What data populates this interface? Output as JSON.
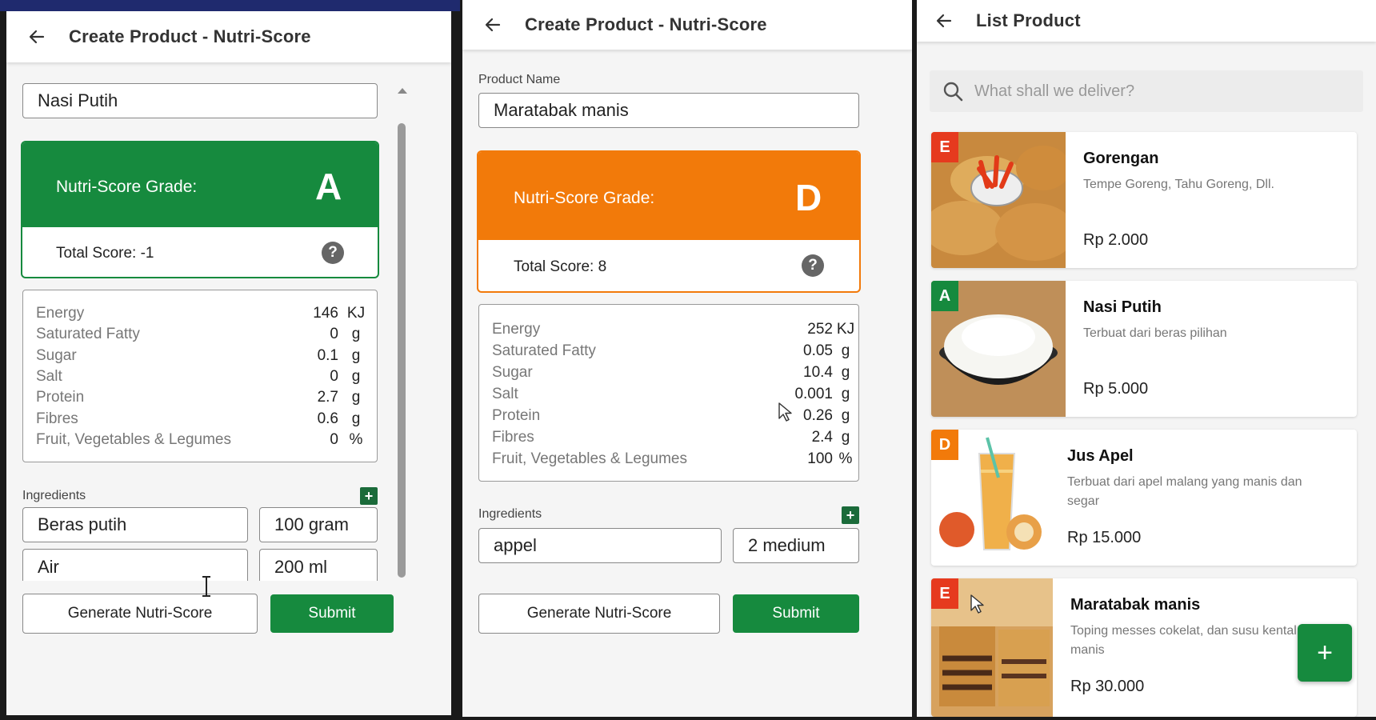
{
  "panel_left": {
    "title": "Create Product - Nutri-Score",
    "product_name_value": "Nasi Putih",
    "grade": {
      "label": "Nutri-Score Grade:",
      "letter": "A",
      "color": "#168a3e",
      "total_score": "Total Score: -1"
    },
    "nutrients": [
      {
        "name": "Energy",
        "value": "146",
        "unit": "KJ"
      },
      {
        "name": "Saturated Fatty",
        "value": "0",
        "unit": "g"
      },
      {
        "name": "Sugar",
        "value": "0.1",
        "unit": "g"
      },
      {
        "name": "Salt",
        "value": "0",
        "unit": "g"
      },
      {
        "name": "Protein",
        "value": "2.7",
        "unit": "g"
      },
      {
        "name": "Fibres",
        "value": "0.6",
        "unit": "g"
      },
      {
        "name": "Fruit, Vegetables & Legumes",
        "value": "0",
        "unit": "%"
      }
    ],
    "ingredients_label": "Ingredients",
    "add_icon": "+",
    "ingredients": [
      {
        "name": "Beras putih",
        "qty": "100 gram"
      },
      {
        "name": "Air",
        "qty": "200 ml"
      }
    ],
    "generate_label": "Generate Nutri-Score",
    "submit_label": "Submit"
  },
  "panel_middle": {
    "title": "Create Product - Nutri-Score",
    "product_name_label": "Product Name",
    "product_name_value": "Maratabak manis",
    "grade": {
      "label": "Nutri-Score Grade:",
      "letter": "D",
      "color": "#f27a0a",
      "total_score": "Total Score: 8"
    },
    "nutrients": [
      {
        "name": "Energy",
        "value": "252",
        "unit": "KJ"
      },
      {
        "name": "Saturated Fatty",
        "value": "0.05",
        "unit": "g"
      },
      {
        "name": "Sugar",
        "value": "10.4",
        "unit": "g"
      },
      {
        "name": "Salt",
        "value": "0.001",
        "unit": "g"
      },
      {
        "name": "Protein",
        "value": "0.26",
        "unit": "g"
      },
      {
        "name": "Fibres",
        "value": "2.4",
        "unit": "g"
      },
      {
        "name": "Fruit, Vegetables & Legumes",
        "value": "100",
        "unit": "%"
      }
    ],
    "ingredients_label": "Ingredients",
    "add_icon": "+",
    "ingredients": [
      {
        "name": "appel",
        "qty": "2 medium"
      }
    ],
    "generate_label": "Generate Nutri-Score",
    "submit_label": "Submit"
  },
  "panel_right": {
    "title": "List Product",
    "search_placeholder": "What shall we deliver?",
    "products": [
      {
        "grade": "E",
        "grade_color": "#e63a1e",
        "name": "Gorengan",
        "desc": "Tempe Goreng, Tahu Goreng, Dll.",
        "price": "Rp 2.000",
        "image": "fried-snacks-image"
      },
      {
        "grade": "A",
        "grade_color": "#168a3e",
        "name": "Nasi Putih",
        "desc": "Terbuat dari beras pilihan",
        "price": "Rp 5.000",
        "image": "rice-bowl-image"
      },
      {
        "grade": "D",
        "grade_color": "#f27a0a",
        "name": "Jus Apel",
        "desc": "Terbuat dari apel malang yang manis dan segar",
        "price": "Rp 15.000",
        "image": "apple-juice-image"
      },
      {
        "grade": "E",
        "grade_color": "#e63a1e",
        "name": "Maratabak manis",
        "desc": "Toping messes cokelat, dan susu kental manis",
        "price": "Rp 30.000",
        "image": "martabak-image"
      }
    ],
    "fab_icon": "+"
  }
}
